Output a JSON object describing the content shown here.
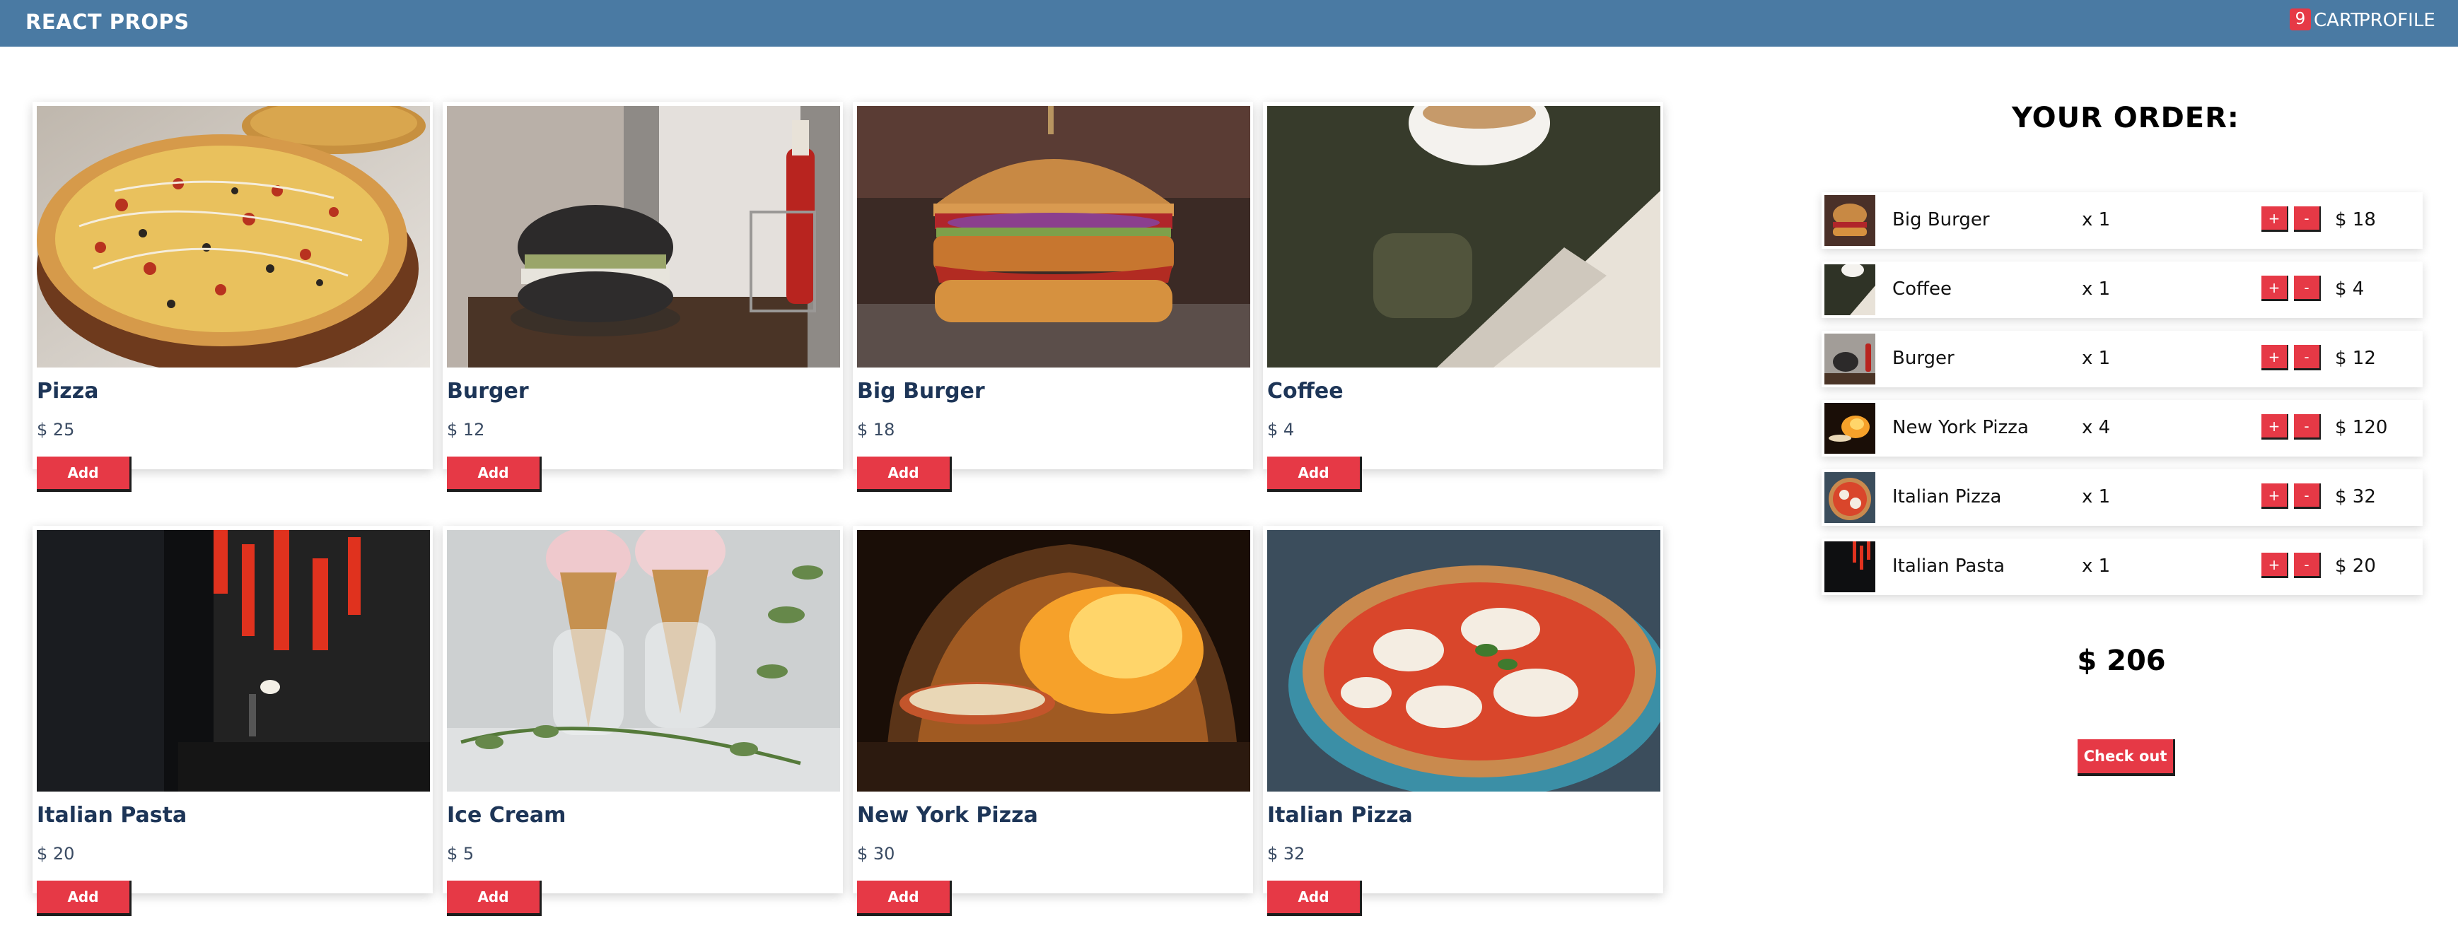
{
  "header": {
    "brand": "REACT PROPS",
    "cart_label": "CART",
    "cart_count": "9",
    "profile_label": "PROFILE"
  },
  "products": [
    {
      "name": "Pizza",
      "price": "$ 25",
      "add_label": "Add",
      "image": "pizza-photo"
    },
    {
      "name": "Burger",
      "price": "$ 12",
      "add_label": "Add",
      "image": "burger-photo"
    },
    {
      "name": "Big Burger",
      "price": "$ 18",
      "add_label": "Add",
      "image": "big-burger-photo"
    },
    {
      "name": "Coffee",
      "price": "$ 4",
      "add_label": "Add",
      "image": "coffee-photo"
    },
    {
      "name": "Italian Pasta",
      "price": "$ 20",
      "add_label": "Add",
      "image": "italian-pasta-photo"
    },
    {
      "name": "Ice Cream",
      "price": "$ 5",
      "add_label": "Add",
      "image": "ice-cream-photo"
    },
    {
      "name": "New York Pizza",
      "price": "$ 30",
      "add_label": "Add",
      "image": "new-york-pizza-photo"
    },
    {
      "name": "Italian Pizza",
      "price": "$ 32",
      "add_label": "Add",
      "image": "italian-pizza-photo"
    }
  ],
  "order": {
    "title": "YOUR ORDER:",
    "items": [
      {
        "name": "Big Burger",
        "qty": "x 1",
        "price": "$ 18",
        "plus": "+",
        "minus": "-"
      },
      {
        "name": "Coffee",
        "qty": "x 1",
        "price": "$ 4",
        "plus": "+",
        "minus": "-"
      },
      {
        "name": "Burger",
        "qty": "x 1",
        "price": "$ 12",
        "plus": "+",
        "minus": "-"
      },
      {
        "name": "New York Pizza",
        "qty": "x 4",
        "price": "$ 120",
        "plus": "+",
        "minus": "-"
      },
      {
        "name": "Italian Pizza",
        "qty": "x 1",
        "price": "$ 32",
        "plus": "+",
        "minus": "-"
      },
      {
        "name": "Italian Pasta",
        "qty": "x 1",
        "price": "$ 20",
        "plus": "+",
        "minus": "-"
      }
    ],
    "total": "$ 206",
    "checkout_label": "Check out"
  },
  "colors": {
    "navbar": "#4a7aa3",
    "accent": "#e63946",
    "title_text": "#1d3557"
  }
}
